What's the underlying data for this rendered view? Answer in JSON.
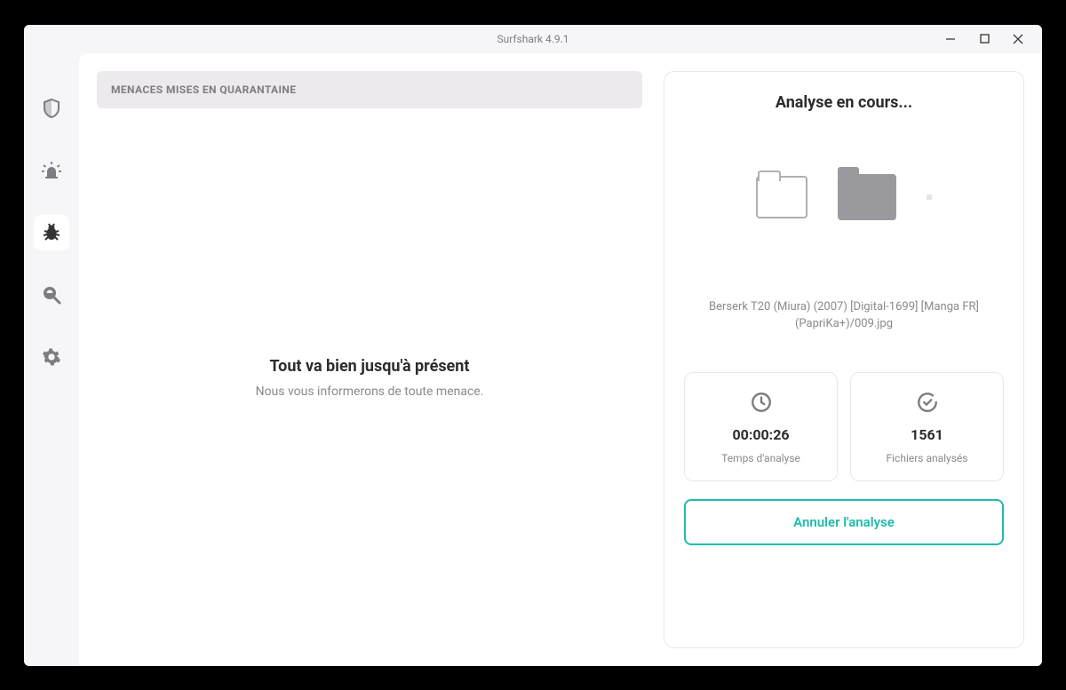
{
  "window": {
    "title": "Surfshark 4.9.1"
  },
  "left": {
    "quarantine_header": "MENACES MISES EN QUARANTAINE",
    "status_title": "Tout va bien jusqu'à présent",
    "status_sub": "Nous vous informerons de toute menace."
  },
  "scan": {
    "title": "Analyse en cours...",
    "filename": "Berserk T20 (Miura) (2007) [Digital-1699] [Manga FR] (PapriKa+)/009.jpg",
    "time_value": "00:00:26",
    "time_label": "Temps d'analyse",
    "files_value": "1561",
    "files_label": "Fichiers analysés",
    "cancel_label": "Annuler l'analyse"
  }
}
